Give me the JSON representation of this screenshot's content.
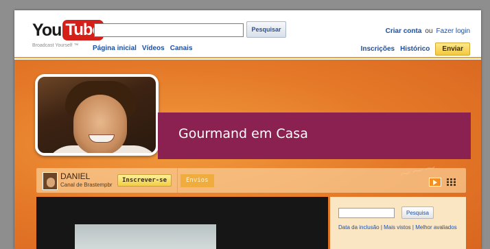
{
  "header": {
    "logo_you": "You",
    "logo_tube": "Tube",
    "tagline": "Broadcast Yourself ™",
    "search_button": "Pesquisar",
    "nav": [
      "Página inicial",
      "Vídeos",
      "Canais"
    ],
    "account": {
      "create": "Criar conta",
      "or": "ou",
      "login": "Fazer login"
    },
    "right_nav": {
      "subscriptions": "Inscrições",
      "history": "Histórico",
      "upload": "Enviar"
    }
  },
  "channel": {
    "title": "Gourmand em Casa",
    "owner": "DANIEL",
    "subtitle": "Canal de Brastempbr",
    "subscribe": "Inscrever-se",
    "tab": "Envios"
  },
  "sidebar": {
    "search_button": "Pesquisa",
    "sort_links": "Data da inclusão | Mais vistos | Melhor avaliados"
  },
  "colors": {
    "brand_red": "#d42019",
    "banner": "#8b2150",
    "orange": "#e47828",
    "link": "#1b4fa1"
  }
}
